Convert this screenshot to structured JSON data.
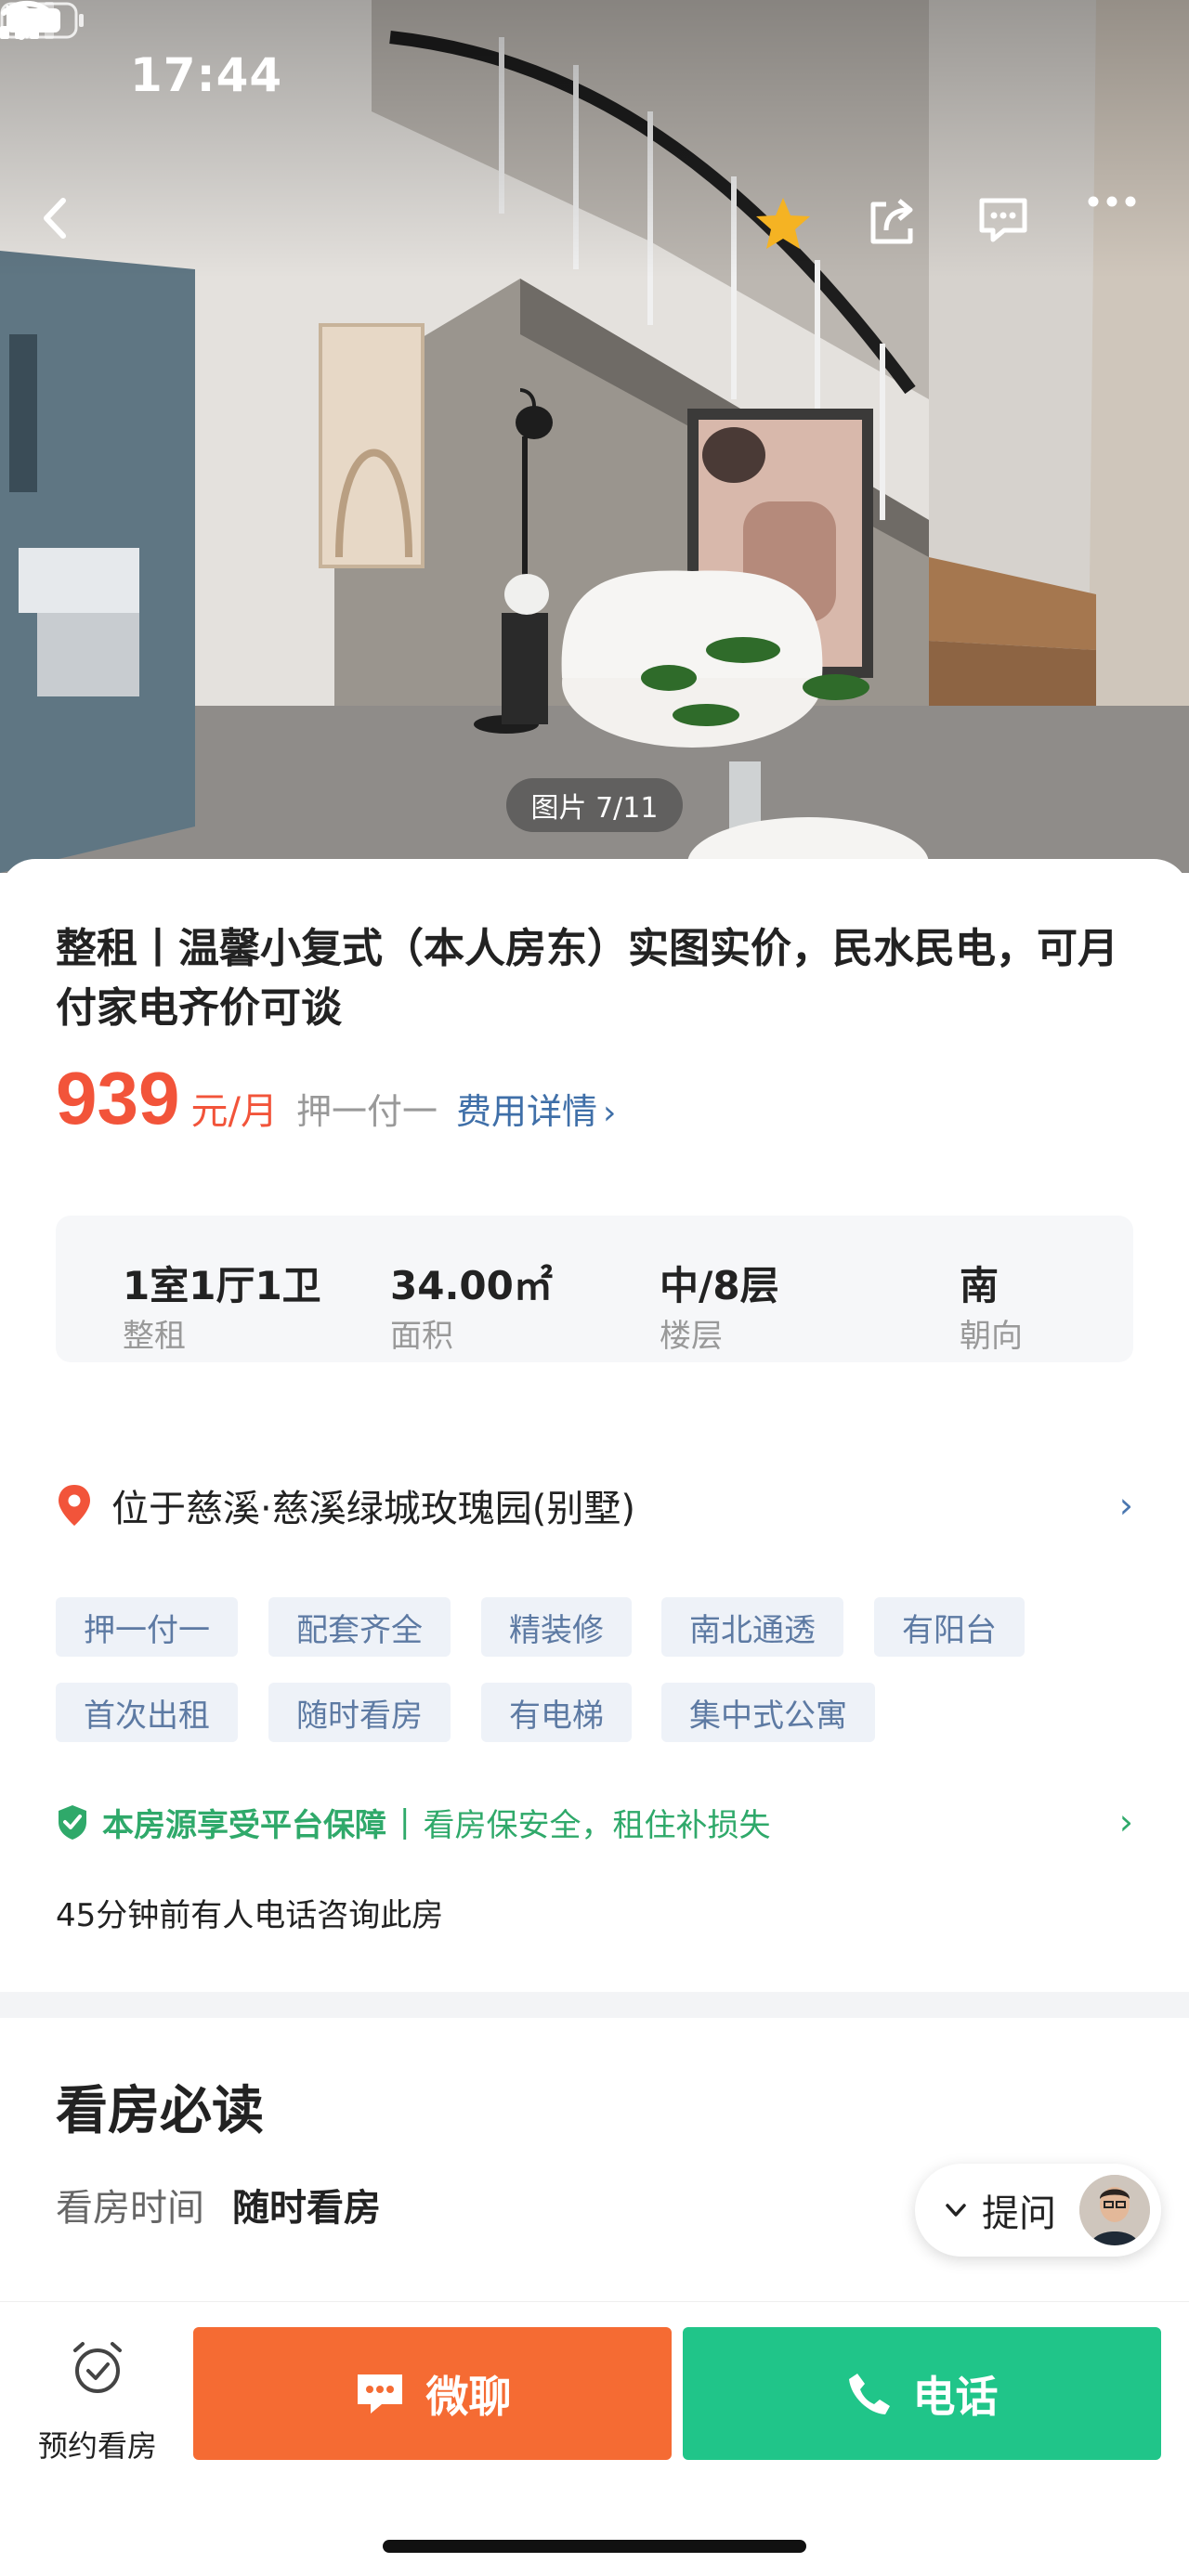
{
  "status_bar": {
    "time": "17:44"
  },
  "gallery": {
    "counter": "图片 7/11"
  },
  "listing": {
    "title": "整租丨温馨小复式（本人房东）实图实价，民水民电，可月付家电齐价可谈",
    "price": "939",
    "price_unit": "元/月",
    "deposit": "押一付一",
    "fee_link": "费用详情"
  },
  "stats": [
    {
      "value": "1室1厅1卫",
      "label": "整租"
    },
    {
      "value": "34.00㎡",
      "label": "面积"
    },
    {
      "value": "中/8层",
      "label": "楼层"
    },
    {
      "value": "南",
      "label": "朝向"
    }
  ],
  "location": {
    "text": "位于慈溪·慈溪绿城玫瑰园(别墅)"
  },
  "tags": [
    "押一付一",
    "配套齐全",
    "精装修",
    "南北通透",
    "有阳台",
    "首次出租",
    "随时看房",
    "有电梯",
    "集中式公寓"
  ],
  "guarantee": {
    "title": "本房源享受平台保障",
    "separator": "|",
    "desc": "看房保安全，租住补损失"
  },
  "consult_note": "45分钟前有人电话咨询此房",
  "viewing": {
    "section_title": "看房必读",
    "time_label": "看房时间",
    "time_value": "随时看房"
  },
  "ask": {
    "label": "提问"
  },
  "bottom_bar": {
    "appointment": "预约看房",
    "chat": "微聊",
    "call": "电话"
  },
  "colors": {
    "price": "#f2543a",
    "chat_button": "#f56b33",
    "call_button": "#20c589",
    "tag_bg": "#eef2f8",
    "guarantee": "#2fa96a",
    "star": "#f5b323"
  }
}
